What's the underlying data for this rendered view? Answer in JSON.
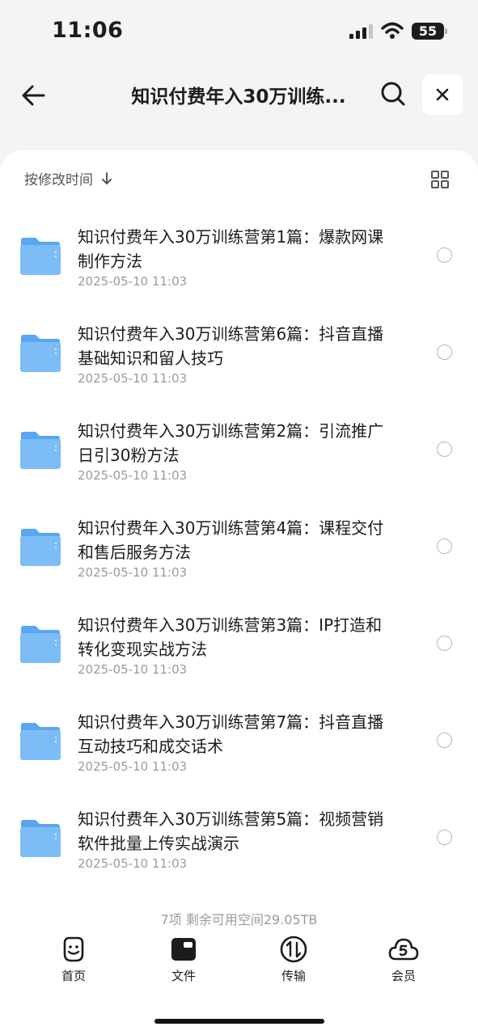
{
  "status_bar": {
    "time": "11:06",
    "battery": "55"
  },
  "header": {
    "title": "知识付费年入30万训练..."
  },
  "sort": {
    "label": "按修改时间"
  },
  "files": [
    {
      "name": "知识付费年入30万训练营第1篇：爆款网课制作方法",
      "date": "2025-05-10 11:03"
    },
    {
      "name": "知识付费年入30万训练营第6篇：抖音直播基础知识和留人技巧",
      "date": "2025-05-10 11:03"
    },
    {
      "name": "知识付费年入30万训练营第2篇：引流推广日引30粉方法",
      "date": "2025-05-10 11:03"
    },
    {
      "name": "知识付费年入30万训练营第4篇：课程交付和售后服务方法",
      "date": "2025-05-10 11:03"
    },
    {
      "name": "知识付费年入30万训练营第3篇：IP打造和转化变现实战方法",
      "date": "2025-05-10 11:03"
    },
    {
      "name": "知识付费年入30万训练营第7篇：抖音直播互动技巧和成交话术",
      "date": "2025-05-10 11:03"
    },
    {
      "name": "知识付费年入30万训练营第5篇：视频营销软件批量上传实战演示",
      "date": "2025-05-10 11:03"
    }
  ],
  "summary": "7项 剩余可用空间29.05TB",
  "tabs": [
    {
      "label": "首页",
      "icon": "smiley-face-icon"
    },
    {
      "label": "文件",
      "icon": "file-folder-icon"
    },
    {
      "label": "传输",
      "icon": "transfer-icon"
    },
    {
      "label": "会员",
      "icon": "cloud-vip-icon"
    }
  ],
  "colors": {
    "folder": "#7cbdf7",
    "folder_dark": "#5aa6f0",
    "accent": "#1c1c1e"
  }
}
